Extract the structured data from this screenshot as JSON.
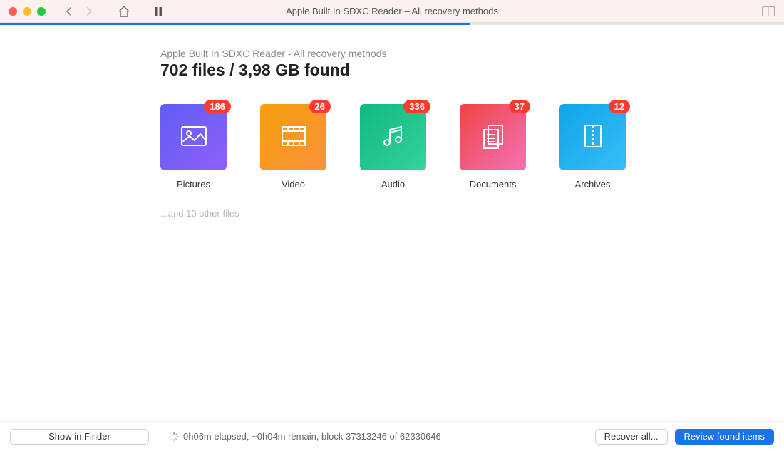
{
  "window": {
    "title": "Apple Built In SDXC Reader – All recovery methods"
  },
  "progress": {
    "percent": 60
  },
  "header": {
    "subtitle": "Apple Built In SDXC Reader - All recovery methods",
    "headline": "702 files / 3,98 GB found"
  },
  "categories": [
    {
      "id": "pictures",
      "label": "Pictures",
      "count": 186,
      "gradient": [
        "#5f5ef6",
        "#8e60f8"
      ],
      "icon": "image"
    },
    {
      "id": "video",
      "label": "Video",
      "count": 26,
      "gradient": [
        "#f59e0b",
        "#fb923c"
      ],
      "icon": "film"
    },
    {
      "id": "audio",
      "label": "Audio",
      "count": 336,
      "gradient": [
        "#10b981",
        "#34d399"
      ],
      "icon": "music"
    },
    {
      "id": "documents",
      "label": "Documents",
      "count": 37,
      "gradient": [
        "#ef4444",
        "#f472b6"
      ],
      "icon": "doc"
    },
    {
      "id": "archives",
      "label": "Archives",
      "count": 12,
      "gradient": [
        "#0ea5e9",
        "#38bdf8"
      ],
      "icon": "zip"
    }
  ],
  "more_files_text": "...and 10 other files",
  "status": "0h06m elapsed, ~0h04m remain, block 37313246 of 62330646",
  "buttons": {
    "show_in_finder": "Show in Finder",
    "recover_all": "Recover all...",
    "review": "Review found items"
  }
}
